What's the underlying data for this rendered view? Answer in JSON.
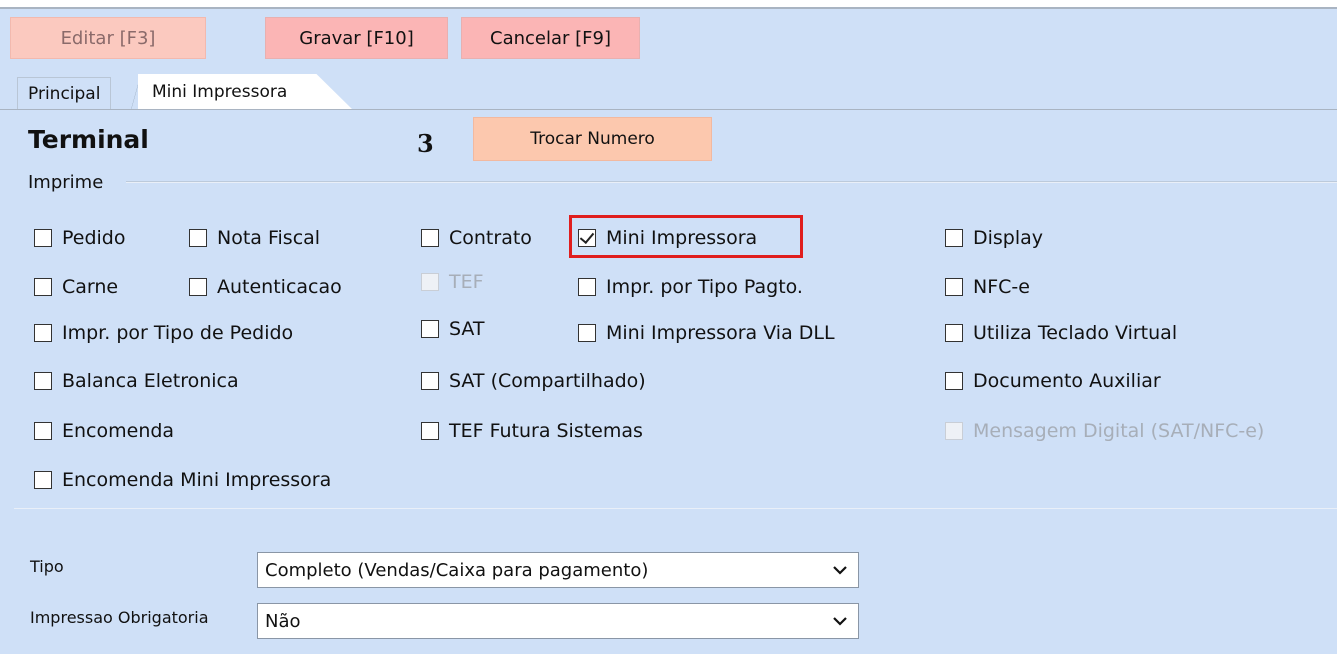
{
  "toolbar": {
    "edit_label": "Editar [F3]",
    "save_label": "Gravar [F10]",
    "cancel_label": "Cancelar [F9]"
  },
  "tabs": [
    {
      "label": "Principal",
      "active": true
    },
    {
      "label": "Mini Impressora",
      "active": false
    }
  ],
  "terminal": {
    "title": "Terminal",
    "number": "3",
    "change_number_label": "Trocar Numero"
  },
  "imprime": {
    "group_label": "Imprime",
    "checkboxes": [
      {
        "label": "Pedido",
        "checked": false,
        "enabled": true
      },
      {
        "label": "Nota Fiscal",
        "checked": false,
        "enabled": true
      },
      {
        "label": "Contrato",
        "checked": false,
        "enabled": true
      },
      {
        "label": "Mini Impressora",
        "checked": true,
        "enabled": true
      },
      {
        "label": "Display",
        "checked": false,
        "enabled": true
      },
      {
        "label": "Carne",
        "checked": false,
        "enabled": true
      },
      {
        "label": "Autenticacao",
        "checked": false,
        "enabled": true
      },
      {
        "label": "TEF",
        "checked": false,
        "enabled": false
      },
      {
        "label": "Impr. por Tipo Pagto.",
        "checked": false,
        "enabled": true
      },
      {
        "label": "NFC-e",
        "checked": false,
        "enabled": true
      },
      {
        "label": "Impr. por Tipo de Pedido",
        "checked": false,
        "enabled": true
      },
      {
        "label": "SAT",
        "checked": false,
        "enabled": true
      },
      {
        "label": "Mini Impressora Via DLL",
        "checked": false,
        "enabled": true
      },
      {
        "label": "Utiliza Teclado Virtual",
        "checked": false,
        "enabled": true
      },
      {
        "label": "Balanca Eletronica",
        "checked": false,
        "enabled": true
      },
      {
        "label": "SAT (Compartilhado)",
        "checked": false,
        "enabled": true
      },
      {
        "label": "Documento Auxiliar",
        "checked": false,
        "enabled": true
      },
      {
        "label": "Encomenda",
        "checked": false,
        "enabled": true
      },
      {
        "label": "TEF Futura Sistemas",
        "checked": false,
        "enabled": true
      },
      {
        "label": "Mensagem Digital (SAT/NFC-e)",
        "checked": false,
        "enabled": false
      },
      {
        "label": "Encomenda Mini Impressora",
        "checked": false,
        "enabled": true
      }
    ]
  },
  "fields": {
    "tipo": {
      "label": "Tipo",
      "value": "Completo (Vendas/Caixa para pagamento)"
    },
    "impressao": {
      "label": "Impressao Obrigatoria",
      "value": "Não"
    }
  },
  "colors": {
    "background": "#cfe0f7",
    "button_primary": "#fbb5b5",
    "button_disabled": "#fbc9bf",
    "button_trocar": "#fcc8ae",
    "highlight": "#e01e1e"
  }
}
